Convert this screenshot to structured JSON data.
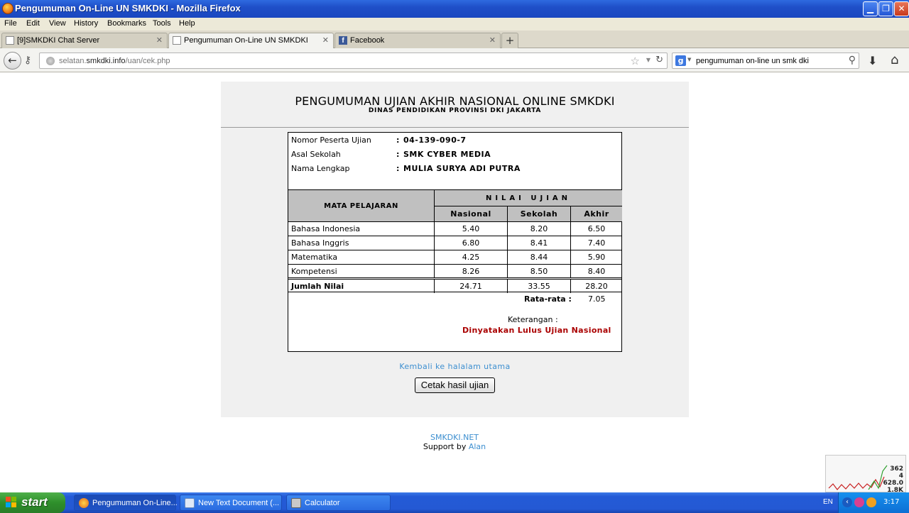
{
  "window": {
    "title": "Pengumuman On-Line UN SMKDKI - Mozilla Firefox",
    "menu": [
      "File",
      "Edit",
      "View",
      "History",
      "Bookmarks",
      "Tools",
      "Help"
    ]
  },
  "tabs": [
    {
      "label": "[9]SMKDKI Chat Server",
      "active": false
    },
    {
      "label": "Pengumuman On-Line UN SMKDKI",
      "active": true
    },
    {
      "label": "Facebook",
      "active": false
    }
  ],
  "nav": {
    "url_prefix": "selatan.",
    "url_domain": "smkdki.info",
    "url_path": "/uan/cek.php",
    "search_value": "pengumuman on-line un smk dki",
    "search_engine": "Google"
  },
  "page": {
    "title": "PENGUMUMAN UJIAN AKHIR NASIONAL ONLINE SMKDKI",
    "subtitle": "DINAS PENDIDIKAN PROVINSI DKI JAKARTA",
    "info": [
      {
        "label": "Nomor Peserta Ujian",
        "value": "04-139-090-7"
      },
      {
        "label": "Asal Sekolah",
        "value": "SMK CYBER MEDIA"
      },
      {
        "label": "Nama Lengkap",
        "value": "MULIA SURYA ADI PUTRA"
      }
    ],
    "colon": ":",
    "table": {
      "subject_header": "MATA PELAJARAN",
      "score_header": "NILAI UJIAN",
      "sub_headers": [
        "Nasional",
        "Sekolah",
        "Akhir"
      ],
      "rows": [
        {
          "subject": "Bahasa Indonesia",
          "nasional": "5.40",
          "sekolah": "8.20",
          "akhir": "6.50"
        },
        {
          "subject": "Bahasa Inggris",
          "nasional": "6.80",
          "sekolah": "8.41",
          "akhir": "7.40"
        },
        {
          "subject": "Matematika",
          "nasional": "4.25",
          "sekolah": "8.44",
          "akhir": "5.90"
        },
        {
          "subject": "Kompetensi",
          "nasional": "8.26",
          "sekolah": "8.50",
          "akhir": "8.40"
        }
      ],
      "total": {
        "label": "Jumlah Nilai",
        "nasional": "24.71",
        "sekolah": "33.55",
        "akhir": "28.20"
      }
    },
    "average_label": "Rata-rata :",
    "average_value": "7.05",
    "note_label": "Keterangan :",
    "note_value": "Dinyatakan Lulus Ujian Nasional",
    "back_link": "Kembali ke halalam utama",
    "print_button": "Cetak hasil ujian",
    "footer_site": "SMKDKI.NET",
    "footer_support": "Support by",
    "footer_author": "Alan"
  },
  "gadget": {
    "values": [
      "362",
      "4",
      "628.0",
      "1.8K"
    ]
  },
  "taskbar": {
    "start": "start",
    "tasks": [
      {
        "label": "Pengumuman On-Line...",
        "active": true
      },
      {
        "label": "New Text Document (...",
        "active": false
      },
      {
        "label": "Calculator",
        "active": false
      }
    ],
    "lang": "EN",
    "clock": "3:17"
  },
  "colors": {
    "link": "#3d8fd0",
    "pass": "#aa0000",
    "panel": "#f0f0f0",
    "header_cell": "#c0c0c0"
  }
}
